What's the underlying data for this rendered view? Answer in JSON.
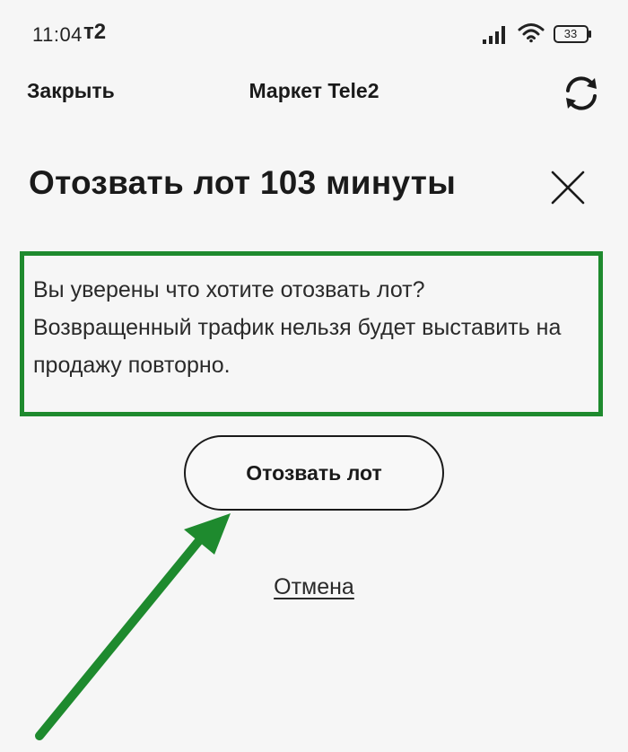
{
  "status_bar": {
    "time": "11:04",
    "carrier": "т2",
    "battery": "33"
  },
  "app_bar": {
    "close_label": "Закрыть",
    "title": "Маркет Tele2",
    "refresh_icon": "refresh-icon"
  },
  "dialog": {
    "title": "Отозвать лот 103 минуты",
    "close_icon": "close-icon",
    "message_lines": [
      "Вы уверены что хотите отозвать лот?",
      "Возвращенный трафик нельзя будет выставить на",
      "продажу повторно."
    ],
    "confirm_label": "Отозвать лот",
    "cancel_label": "Отмена"
  },
  "colors": {
    "highlight": "#1e8a2e",
    "arrow": "#1e8a2e",
    "background": "#f6f6f6"
  }
}
